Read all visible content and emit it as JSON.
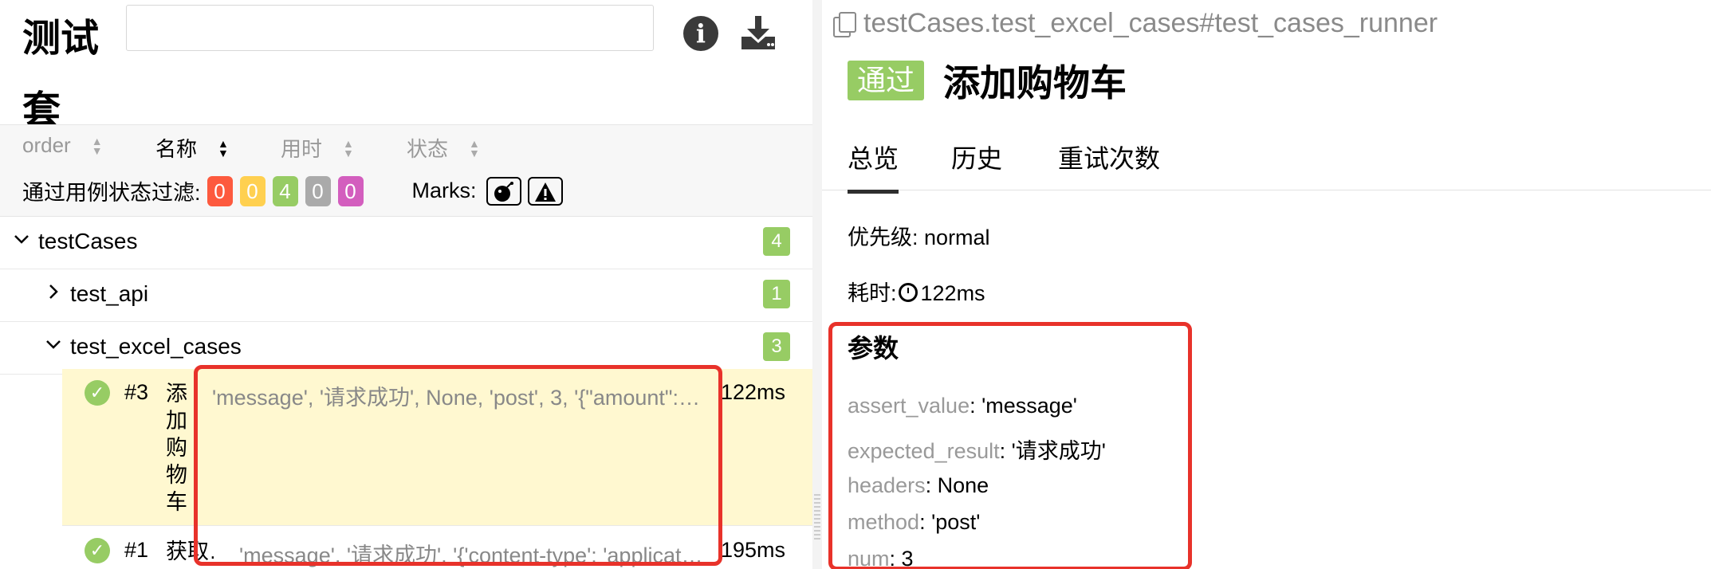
{
  "left": {
    "title": "测试套",
    "search_value": "",
    "icons": {
      "info": "info-icon",
      "download": "download-icon"
    },
    "sort": [
      {
        "label": "order",
        "active": false
      },
      {
        "label": "名称",
        "active": true
      },
      {
        "label": "用时",
        "active": false
      },
      {
        "label": "状态",
        "active": false
      }
    ],
    "filter": {
      "label": "通过用例状态过滤:",
      "counts": [
        {
          "value": "0",
          "color": "#fd5a3e"
        },
        {
          "value": "0",
          "color": "#ffd050"
        },
        {
          "value": "4",
          "color": "#97cc64"
        },
        {
          "value": "0",
          "color": "#aaaaaa"
        },
        {
          "value": "0",
          "color": "#d35ebe"
        }
      ],
      "marks_label": "Marks:",
      "marks": [
        "bomb-icon",
        "warning-icon"
      ]
    },
    "tree": [
      {
        "label": "testCases",
        "count": "4",
        "expanded": true
      },
      {
        "label": "test_api",
        "count": "1",
        "expanded": false
      },
      {
        "label": "test_excel_cases",
        "count": "3",
        "expanded": true
      }
    ],
    "cases": [
      {
        "order": "#3",
        "name": "添加购物车",
        "params": "'message', '请求成功', None, 'post', 3, '{\"amount\":…",
        "duration": "122ms",
        "selected": true
      },
      {
        "order": "#1",
        "name": "获取…",
        "params": "'message', '请求成功', '{'content-type': 'applicat…",
        "duration": "195ms",
        "selected": false
      }
    ]
  },
  "right": {
    "breadcrumb": "testCases.test_excel_cases#test_cases_runner",
    "status_badge": "通过",
    "title": "添加购物车",
    "tabs": [
      "总览",
      "历史",
      "重试次数"
    ],
    "priority_label": "优先级:",
    "priority_value": "normal",
    "duration_label": "耗时:",
    "duration_value": "122ms",
    "params_title": "参数",
    "params": [
      {
        "key": "assert_value",
        "value": ": 'message'"
      },
      {
        "key": "expected_result",
        "value": ": '请求成功'"
      },
      {
        "key": "headers",
        "value": ": None"
      },
      {
        "key": "method",
        "value": ": 'post'"
      },
      {
        "key": "num",
        "value": ": 3"
      }
    ]
  },
  "colors": {
    "passed": "#97cc64",
    "highlight": "#e8322a",
    "selected_row": "#fff8d0"
  }
}
